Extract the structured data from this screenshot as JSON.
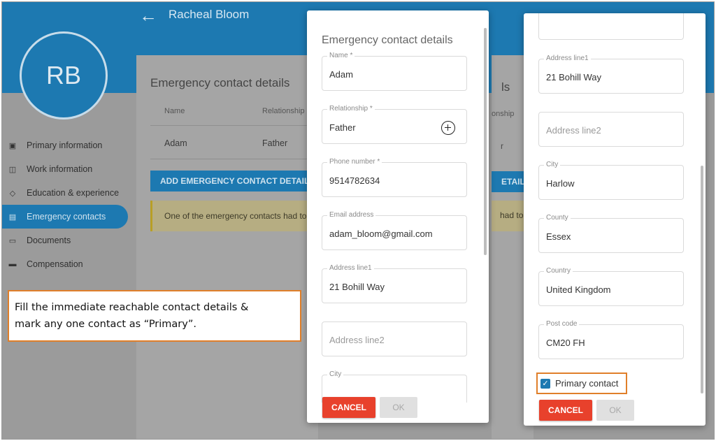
{
  "header": {
    "user_name": "Racheal Bloom",
    "avatar_initials": "RB"
  },
  "sidebar": {
    "items": [
      {
        "label": "Primary information",
        "icon": "id-card-icon"
      },
      {
        "label": "Work information",
        "icon": "briefcase-icon"
      },
      {
        "label": "Education & experience",
        "icon": "graduation-cap-icon"
      },
      {
        "label": "Emergency contacts",
        "icon": "contact-card-icon"
      },
      {
        "label": "Documents",
        "icon": "folder-icon"
      },
      {
        "label": "Compensation",
        "icon": "credit-card-icon"
      }
    ],
    "active_index": 3
  },
  "background_card": {
    "title": "Emergency contact details",
    "columns": [
      "Name",
      "Relationship"
    ],
    "rows": [
      {
        "name": "Adam",
        "relationship": "Father"
      }
    ],
    "add_button": "ADD EMERGENCY CONTACT DETAILS",
    "warning": "One of the emergency contacts had to",
    "right_fragments": {
      "title": "ls",
      "col": "onship",
      "cell": "r",
      "btn": "ETAILS",
      "warn": "had to"
    }
  },
  "callout": {
    "line1": "Fill the immediate reachable contact details &",
    "line2": "mark any one contact as “Primary”."
  },
  "dialog1": {
    "title": "Emergency contact details",
    "fields": {
      "name": {
        "label": "Name *",
        "value": "Adam"
      },
      "relationship": {
        "label": "Relationship *",
        "value": "Father"
      },
      "phone": {
        "label": "Phone number *",
        "value": "9514782634"
      },
      "email": {
        "label": "Email address",
        "value": "adam_bloom@gmail.com"
      },
      "address1": {
        "label": "Address line1",
        "value": "21 Bohill Way"
      },
      "address2": {
        "placeholder": "Address line2"
      },
      "city": {
        "label": "City",
        "value": ""
      }
    },
    "cancel": "CANCEL",
    "ok": "OK"
  },
  "dialog2": {
    "fields": {
      "address1": {
        "label": "Address line1",
        "value": "21 Bohill Way"
      },
      "address2": {
        "placeholder": "Address line2"
      },
      "city": {
        "label": "City",
        "value": "Harlow"
      },
      "county": {
        "label": "County",
        "value": "Essex"
      },
      "country": {
        "label": "Country",
        "value": "United Kingdom"
      },
      "postcode": {
        "label": "Post code",
        "value": "CM20 FH"
      }
    },
    "primary_contact": {
      "label": "Primary contact",
      "checked": true
    },
    "cancel": "CANCEL",
    "ok": "OK"
  },
  "colors": {
    "brand": "#1d79b1",
    "cancel": "#e8412c",
    "highlight": "#e07f2a"
  }
}
